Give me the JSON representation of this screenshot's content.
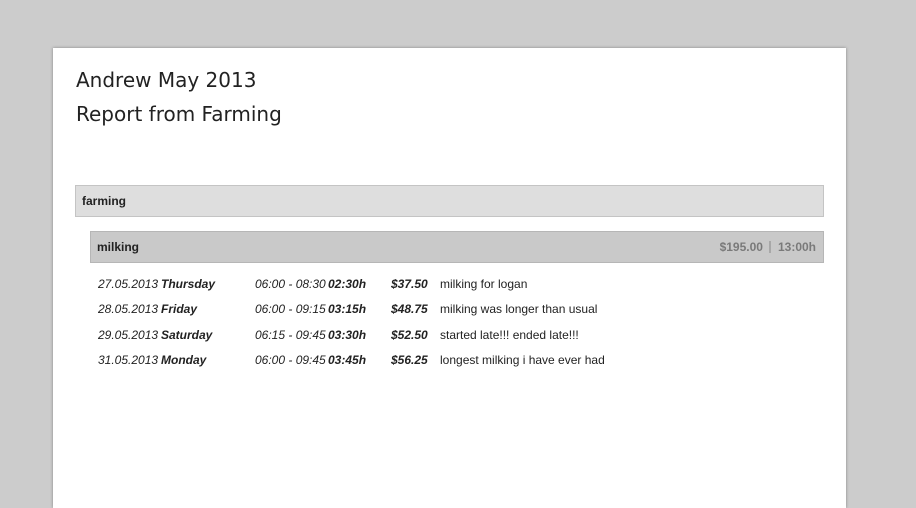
{
  "report": {
    "title": "Andrew May 2013",
    "subtitle": "Report from Farming"
  },
  "project": {
    "name": "farming"
  },
  "task": {
    "name": "milking",
    "total_amount": "$195.00",
    "total_hours": "13:00h"
  },
  "entries": [
    {
      "date": "27.05.2013",
      "weekday": "Thursday",
      "time_range": "06:00 - 08:30",
      "duration": "02:30h",
      "amount": "$37.50",
      "description": "milking for logan"
    },
    {
      "date": "28.05.2013",
      "weekday": "Friday",
      "time_range": "06:00 - 09:15",
      "duration": "03:15h",
      "amount": "$48.75",
      "description": "milking was longer than usual"
    },
    {
      "date": "29.05.2013",
      "weekday": "Saturday",
      "time_range": "06:15 - 09:45",
      "duration": "03:30h",
      "amount": "$52.50",
      "description": "started late!!! ended late!!!"
    },
    {
      "date": "31.05.2013",
      "weekday": "Monday",
      "time_range": "06:00 - 09:45",
      "duration": "03:45h",
      "amount": "$56.25",
      "description": "longest milking i have ever had"
    }
  ]
}
